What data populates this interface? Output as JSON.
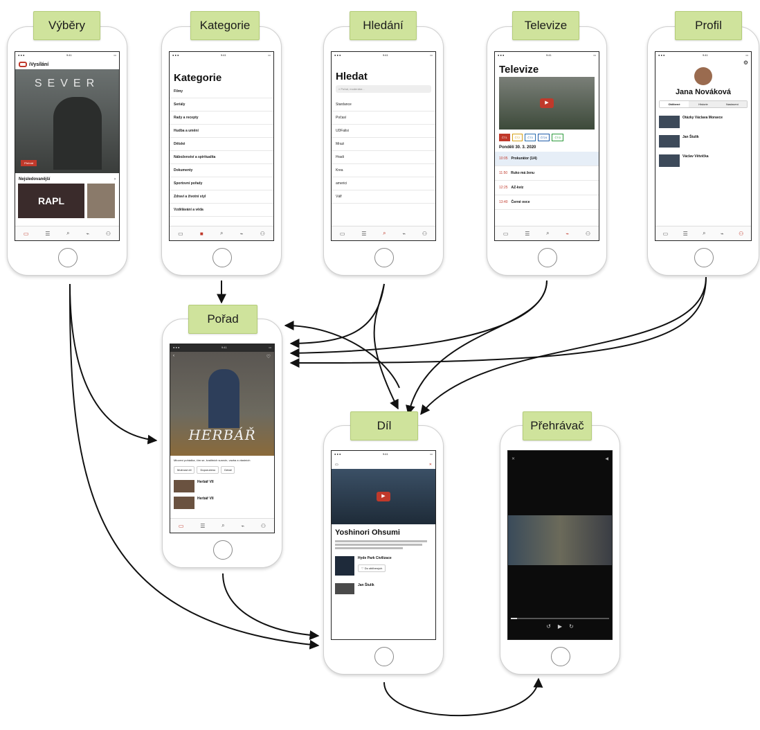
{
  "labels": {
    "vybery": "Výběry",
    "kategorie": "Kategorie",
    "hledani": "Hledání",
    "televize": "Televize",
    "profil": "Profil",
    "porad": "Pořad",
    "dil": "Díl",
    "prehravac": "Přehrávač"
  },
  "vybery_screen": {
    "logo": "iVysílání",
    "banner_title": "SEVER",
    "play": "Přehrát",
    "section": "Nejsledovanější",
    "thumb": "RAPL"
  },
  "kategorie_screen": {
    "title": "Kategorie",
    "items": [
      "Filmy",
      "Seriály",
      "Rady a recepty",
      "Hudba a umění",
      "Dětské",
      "Náboženství a spiritualita",
      "Dokumenty",
      "Sportovní pořady",
      "Zdraví a životní styl",
      "Vzdělávání a věda"
    ]
  },
  "hledat_screen": {
    "title": "Hledat",
    "search_placeholder": "Pořad, moderátor...",
    "items": [
      "Stardance",
      "Počasí",
      "UDFalisi",
      "Mrazi",
      "Hradi",
      "Krea",
      "americi",
      "Válf"
    ]
  },
  "televize_screen": {
    "title": "Televize",
    "channels": [
      "ČT1",
      "ČT2",
      "ČT3",
      "ČT24",
      "ČT:D"
    ],
    "date": "Pondělí 30. 3. 2020",
    "schedule": [
      {
        "time": "10:05",
        "title": "Prokurátor (1/4)"
      },
      {
        "time": "11:50",
        "title": "Ruko má ženu"
      },
      {
        "time": "12:25",
        "title": "AZ-kvíz"
      },
      {
        "time": "13:40",
        "title": "Černé ovce"
      }
    ]
  },
  "profil_screen": {
    "name": "Jana Nováková",
    "tabs": [
      "Oblíbené",
      "Historie",
      "Nastavení"
    ],
    "items": [
      {
        "title": "Otázky Václava Moravce"
      },
      {
        "title": "Jan Štulík"
      },
      {
        "title": "Václav Větvička"
      }
    ]
  },
  "porad_screen": {
    "show_title": "HERBÁŘ",
    "description": "Mluvení pohádka, čím se, kvalitních surovin, vazba a vlastních",
    "buttons": [
      "Možnost díl",
      "Doporučeno",
      "Detail"
    ],
    "episodes": [
      {
        "title": "Herbář VII"
      },
      {
        "title": "Herbář VII"
      }
    ]
  },
  "dil_screen": {
    "title": "Yoshinori Ohsumi",
    "program": "Hyde Park Civilizace",
    "follow": "Do oblíbených",
    "related": "Jan Štulík"
  }
}
